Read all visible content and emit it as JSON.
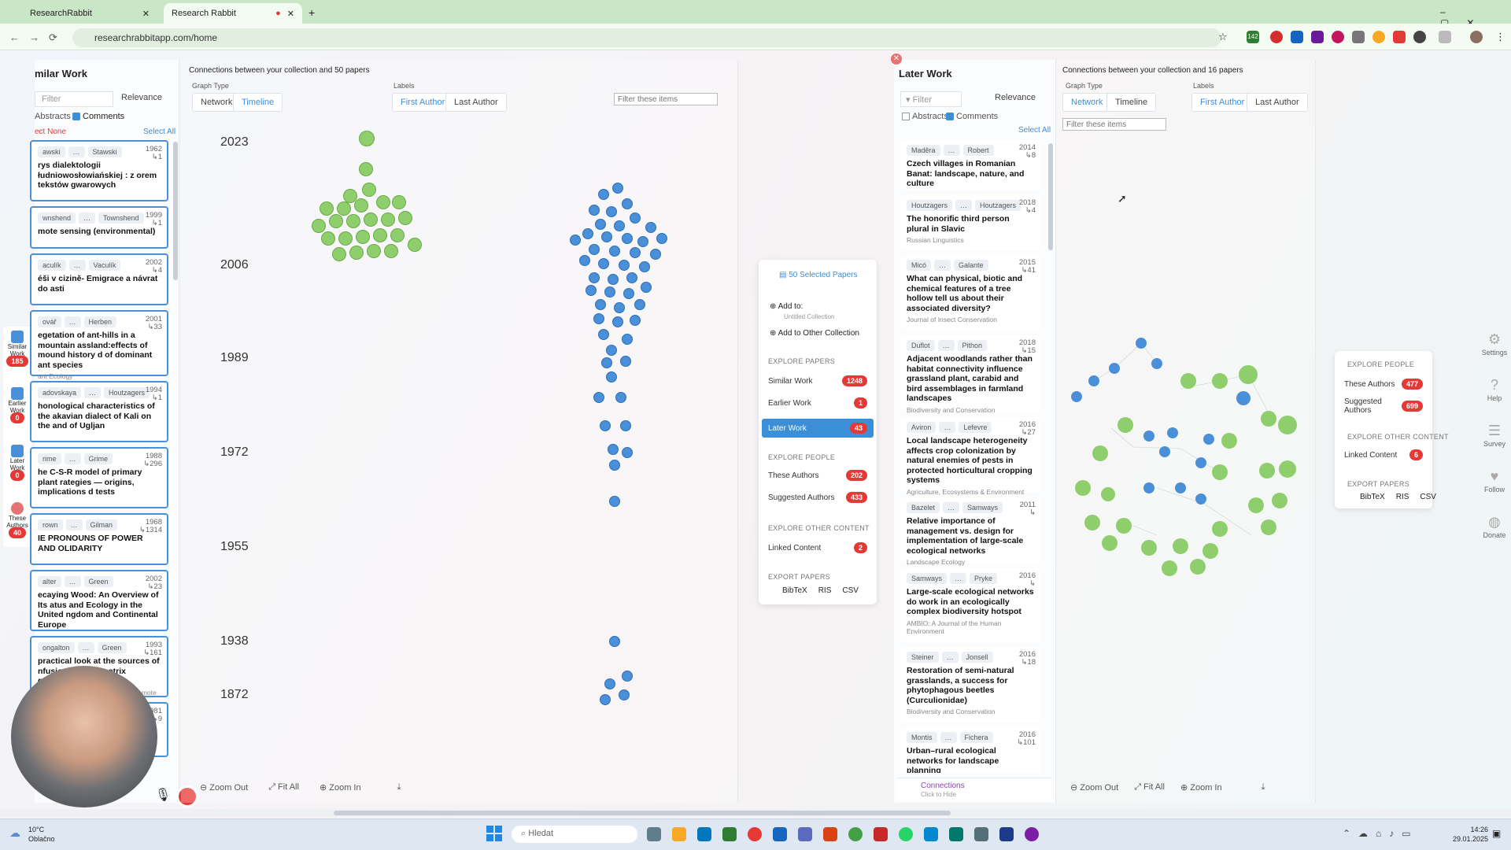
{
  "browser": {
    "tabs": [
      {
        "title": "ResearchRabbit",
        "active": false
      },
      {
        "title": "Research Rabbit",
        "active": true
      }
    ],
    "url": "researchrabbitapp.com/home",
    "ext_badge": "142"
  },
  "left_panel": {
    "title": "milar Work",
    "filter_placeholder": "Filter",
    "sort": "Relevance",
    "abstracts": "Abstracts",
    "comments": "Comments",
    "select_none": "ect None",
    "select_all": "Select All",
    "cards": [
      {
        "authors": [
          "awski",
          "Stawski"
        ],
        "year": "1962",
        "cites": "↳1",
        "title": "rys dialektologii łudniowosłowiańskiej : z orem tekstów gwarowych",
        "journal": ""
      },
      {
        "authors": [
          "wnshend",
          "Townshend"
        ],
        "year": "1999",
        "cites": "↳1",
        "title": "mote sensing (environmental)",
        "journal": ""
      },
      {
        "authors": [
          "aculík",
          "Vaculík"
        ],
        "year": "2002",
        "cites": "↳4",
        "title": "éši v cizině- Emigrace a návrat do asti",
        "journal": ""
      },
      {
        "authors": [
          "ovář",
          "Herben"
        ],
        "year": "2001",
        "cites": "↳33",
        "title": "egetation of ant-hills in a mountain assland:effects of mound history d of dominant ant species",
        "journal": "ant Ecology"
      },
      {
        "authors": [
          "adovskaya",
          "Houtzagers"
        ],
        "year": "1994",
        "cites": "↳1",
        "title": "honological characteristics of the akavian dialect of Kali on the and of Ugljan",
        "journal": ""
      },
      {
        "authors": [
          "rime",
          "Grime"
        ],
        "year": "1988",
        "cites": "↳296",
        "title": "he C-S-R model of primary plant rategies — origins, implications d tests",
        "journal": ""
      },
      {
        "authors": [
          "rown",
          "Gilman"
        ],
        "year": "1968",
        "cites": "↳1314",
        "title": "IE PRONOUNS OF POWER AND OLIDARITY",
        "journal": ""
      },
      {
        "authors": [
          "alter",
          "Green"
        ],
        "year": "2002",
        "cites": "↳23",
        "title": "ecaying Wood: An Overview of Its atus and Ecology in the United ngdom and Continental Europe",
        "journal": ""
      },
      {
        "authors": [
          "ongalton",
          "Green"
        ],
        "year": "1993",
        "cites": "↳161",
        "title": "practical look at the sources of nfusion in error matrix generation",
        "journal": "otogrammetric Engineering and Remote"
      },
      {
        "authors": [
          "",
          ""
        ],
        "year": "1981",
        "cites": "↳9",
        "title": "",
        "journal": ""
      }
    ]
  },
  "sidebar_mini": [
    {
      "label": "Similar Work",
      "count": "185"
    },
    {
      "label": "Earlier Work",
      "count": "0"
    },
    {
      "label": "Later Work",
      "count": "0"
    },
    {
      "label": "These Authors",
      "count": "40"
    }
  ],
  "graph1": {
    "caption": "Connections between your collection and 50 papers",
    "graph_type_label": "Graph Type",
    "network": "Network",
    "timeline": "Timeline",
    "labels_label": "Labels",
    "first_author": "First Author",
    "last_author": "Last Author",
    "filter_placeholder": "Filter these items",
    "years": [
      "2023",
      "2006",
      "1989",
      "1972",
      "1955",
      "1938",
      "1872"
    ],
    "zoom_out": "Zoom Out",
    "fit_all": "Fit All",
    "zoom_in": "Zoom In"
  },
  "menu": {
    "selected": "50 Selected Papers",
    "add_to": "Add to:",
    "untitled": "Untitled Collection",
    "add_other": "Add to Other Collection",
    "explore_papers": "EXPLORE PAPERS",
    "similar": {
      "label": "Similar Work",
      "count": "1248"
    },
    "earlier": {
      "label": "Earlier Work",
      "count": "1"
    },
    "later": {
      "label": "Later Work",
      "count": "43"
    },
    "explore_people": "EXPLORE PEOPLE",
    "authors": {
      "label": "These Authors",
      "count": "202"
    },
    "suggested": {
      "label": "Suggested Authors",
      "count": "433"
    },
    "explore_other": "EXPLORE OTHER CONTENT",
    "linked": {
      "label": "Linked Content",
      "count": "2"
    },
    "export": "EXPORT PAPERS",
    "bibtex": "BibTeX",
    "ris": "RIS",
    "csv": "CSV"
  },
  "later_panel": {
    "title": "Later Work",
    "filter_placeholder": "Filter",
    "sort": "Relevance",
    "abstracts": "Abstracts",
    "comments": "Comments",
    "select_all": "Select All",
    "cards": [
      {
        "a1": "Madêra",
        "a2": "Robert",
        "year": "2014",
        "cites": "↳8",
        "title": "Czech villages in Romanian Banat: landscape, nature, and culture",
        "journal": ""
      },
      {
        "a1": "Houtzagers",
        "a2": "Houtzagers",
        "year": "2018",
        "cites": "↳4",
        "title": "The honorific third person plural in Slavic",
        "journal": "Russian Linguistics"
      },
      {
        "a1": "Micó",
        "a2": "Galante",
        "year": "2015",
        "cites": "↳41",
        "title": "What can physical, biotic and chemical features of a tree hollow tell us about their associated diversity?",
        "journal": "Journal of Insect Conservation"
      },
      {
        "a1": "Duflot",
        "a2": "Pithon",
        "year": "2018",
        "cites": "↳15",
        "title": "Adjacent woodlands rather than habitat connectivity influence grassland plant, carabid and bird assemblages in farmland landscapes",
        "journal": "Biodiversity and Conservation"
      },
      {
        "a1": "Aviron",
        "a2": "Lefevre",
        "year": "2016",
        "cites": "↳27",
        "title": "Local landscape heterogeneity affects crop colonization by natural enemies of pests in protected horticultural cropping systems",
        "journal": "Agriculture, Ecosystems & Environment"
      },
      {
        "a1": "Bazelet",
        "a2": "Samways",
        "year": "2011",
        "cites": "↳",
        "title": "Relative importance of management vs. design for implementation of large-scale ecological networks",
        "journal": "Landscape Ecology"
      },
      {
        "a1": "Samways",
        "a2": "Pryke",
        "year": "2016",
        "cites": "↳",
        "title": "Large-scale ecological networks do work in an ecologically complex biodiversity hotspot",
        "journal": "AMBIO: A Journal of the Human Environment"
      },
      {
        "a1": "Steiner",
        "a2": "Jonsell",
        "year": "2016",
        "cites": "↳18",
        "title": "Restoration of semi-natural grasslands, a success for phytophagous beetles (Curculionidae)",
        "journal": "Biodiversity and Conservation"
      },
      {
        "a1": "Montis",
        "a2": "Fichera",
        "year": "2016",
        "cites": "↳101",
        "title": "Urban–rural ecological networks for landscape planning",
        "journal": ""
      }
    ],
    "connections": "Connections",
    "click_hide": "Click to Hide"
  },
  "graph2": {
    "caption": "Connections between your collection and 16 papers",
    "graph_type_label": "Graph Type",
    "network": "Network",
    "timeline": "Timeline",
    "labels_label": "Labels",
    "first_author": "First Author",
    "last_author": "Last Author",
    "filter_placeholder": "Filter these items",
    "zoom_out": "Zoom Out",
    "fit_all": "Fit All",
    "zoom_in": "Zoom In"
  },
  "right_menu": {
    "explore_people": "EXPLORE PEOPLE",
    "authors": {
      "label": "These Authors",
      "count": "477"
    },
    "suggested": {
      "label": "Suggested Authors",
      "count": "699"
    },
    "explore_other": "EXPLORE OTHER CONTENT",
    "linked": {
      "label": "Linked Content",
      "count": "6"
    },
    "export": "EXPORT PAPERS",
    "bibtex": "BibTeX",
    "ris": "RIS",
    "csv": "CSV"
  },
  "right_rail": [
    "Settings",
    "Help",
    "Survey",
    "Follow",
    "Donate"
  ],
  "taskbar": {
    "weather_temp": "10°C",
    "weather_desc": "Oblačno",
    "search_placeholder": "Hledat",
    "time": "14:26",
    "date": "29.01.2025"
  },
  "colors": {
    "accent": "#4a90d9",
    "badge": "#e53935",
    "node_green": "#8fce6c"
  }
}
